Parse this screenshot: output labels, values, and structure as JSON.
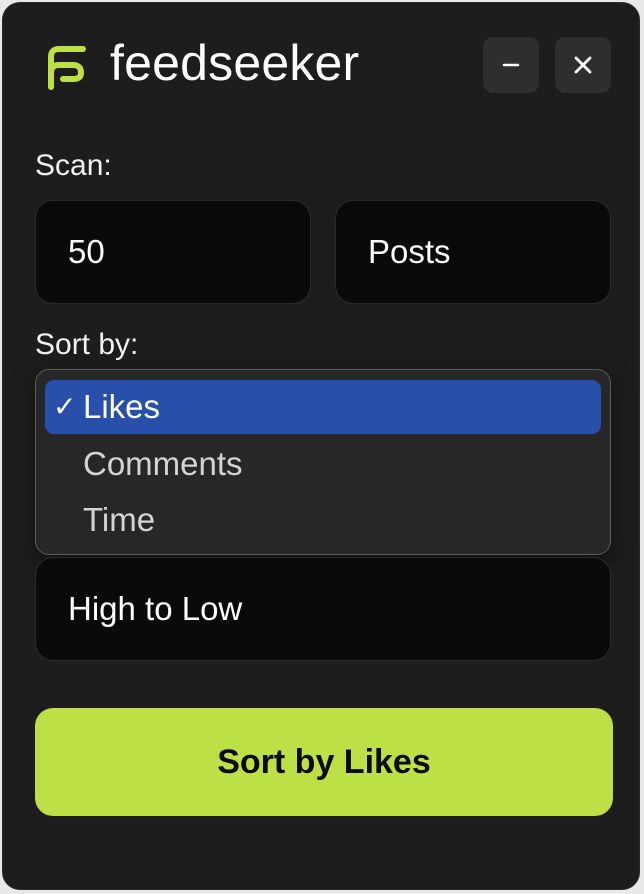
{
  "app": {
    "name": "feedseeker",
    "logo_icon": "feedseeker-logo-icon",
    "accent_color": "#bde046"
  },
  "window_controls": {
    "minimize_icon": "minimize-icon",
    "close_icon": "close-icon"
  },
  "scan": {
    "label": "Scan:",
    "count_value": "50",
    "unit_value": "Posts"
  },
  "sort": {
    "label": "Sort by:",
    "options": [
      {
        "label": "Likes",
        "selected": true
      },
      {
        "label": "Comments",
        "selected": false
      },
      {
        "label": "Time",
        "selected": false
      }
    ],
    "checkmark": "✓",
    "order_value": "High to Low"
  },
  "action": {
    "button_label": "Sort by Likes"
  }
}
